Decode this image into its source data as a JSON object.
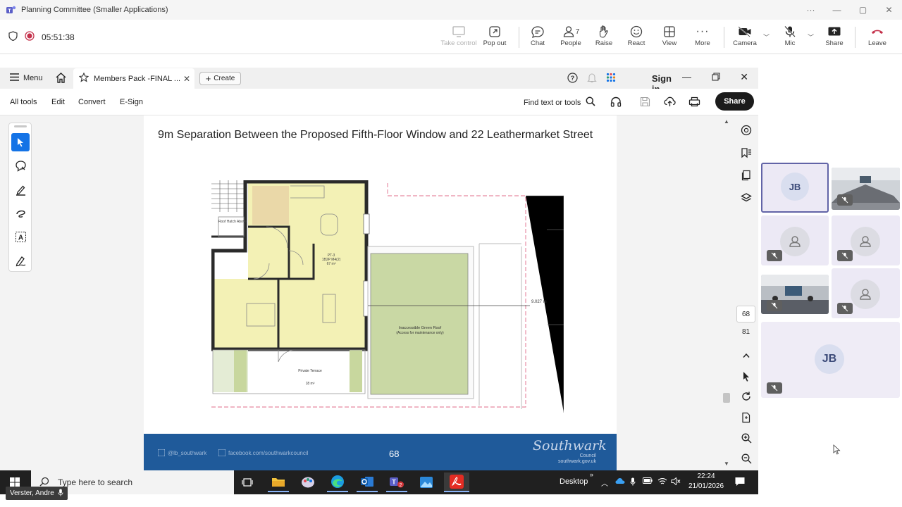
{
  "teams": {
    "window_title": "Planning Committee (Smaller Applications)",
    "recording_time": "05:51:38",
    "controls": [
      {
        "id": "take-control",
        "label": "Take control",
        "icon": "screen-share-icon",
        "disabled": true
      },
      {
        "id": "pop-out",
        "label": "Pop out",
        "icon": "pop-out-icon"
      },
      {
        "id": "chat",
        "label": "Chat",
        "icon": "chat-icon"
      },
      {
        "id": "people",
        "label": "People",
        "icon": "people-icon",
        "count": "7"
      },
      {
        "id": "raise",
        "label": "Raise",
        "icon": "hand-icon"
      },
      {
        "id": "react",
        "label": "React",
        "icon": "smiley-icon"
      },
      {
        "id": "view",
        "label": "View",
        "icon": "grid-icon"
      },
      {
        "id": "more",
        "label": "More",
        "icon": "more-icon"
      },
      {
        "id": "camera",
        "label": "Camera",
        "icon": "camera-off-icon"
      },
      {
        "id": "mic",
        "label": "Mic",
        "icon": "mic-off-icon"
      },
      {
        "id": "share",
        "label": "Share",
        "icon": "share-arrow-icon"
      },
      {
        "id": "leave",
        "label": "Leave",
        "icon": "phone-hangup-icon"
      }
    ],
    "participants": [
      {
        "initials": "JB",
        "selected": true
      },
      {
        "type": "room-video"
      },
      {
        "type": "person"
      },
      {
        "type": "person"
      },
      {
        "type": "room-video"
      },
      {
        "type": "person"
      },
      {
        "initials": "JB"
      }
    ],
    "presenter_name": "Verster, Andre"
  },
  "acrobat": {
    "menu_label": "Menu",
    "tab_title": "Members Pack -FINAL ...",
    "create_label": "Create",
    "signin_label": "Sign in",
    "toolbar": {
      "all_tools": "All tools",
      "edit": "Edit",
      "convert": "Convert",
      "esign": "E-Sign",
      "find": "Find text or tools",
      "share": "Share"
    },
    "page_number_box": "68",
    "page_total": "81",
    "colors": {
      "accent": "#1473e6",
      "footer": "#1f5a9a"
    }
  },
  "document": {
    "heading": "9m Separation Between the Proposed Fifth-Floor Window and 22 Leathermarket Street",
    "plan": {
      "roof_hatch": "Roof Hatch Above",
      "unit": "PT-3",
      "unit_type": "1B2P M4(2)",
      "unit_area": "67 m²",
      "distance": "9.027 m",
      "green_roof": "Inaccessible Green Roof",
      "green_roof_note": "(Access for maintenance only)",
      "terrace": "Private Terrace",
      "terrace_area": "18 m²"
    },
    "footer": {
      "twitter": "@lb_southwark",
      "facebook": "facebook.com/southwarkcouncil",
      "page_number": "68",
      "logo": "Southwark",
      "logo_sub1": "Council",
      "logo_sub2": "southwark.gov.uk"
    }
  },
  "taskbar": {
    "search_placeholder": "Type here to search",
    "desktop_label": "Desktop",
    "time": "22:24",
    "date": "21/01/2026"
  }
}
